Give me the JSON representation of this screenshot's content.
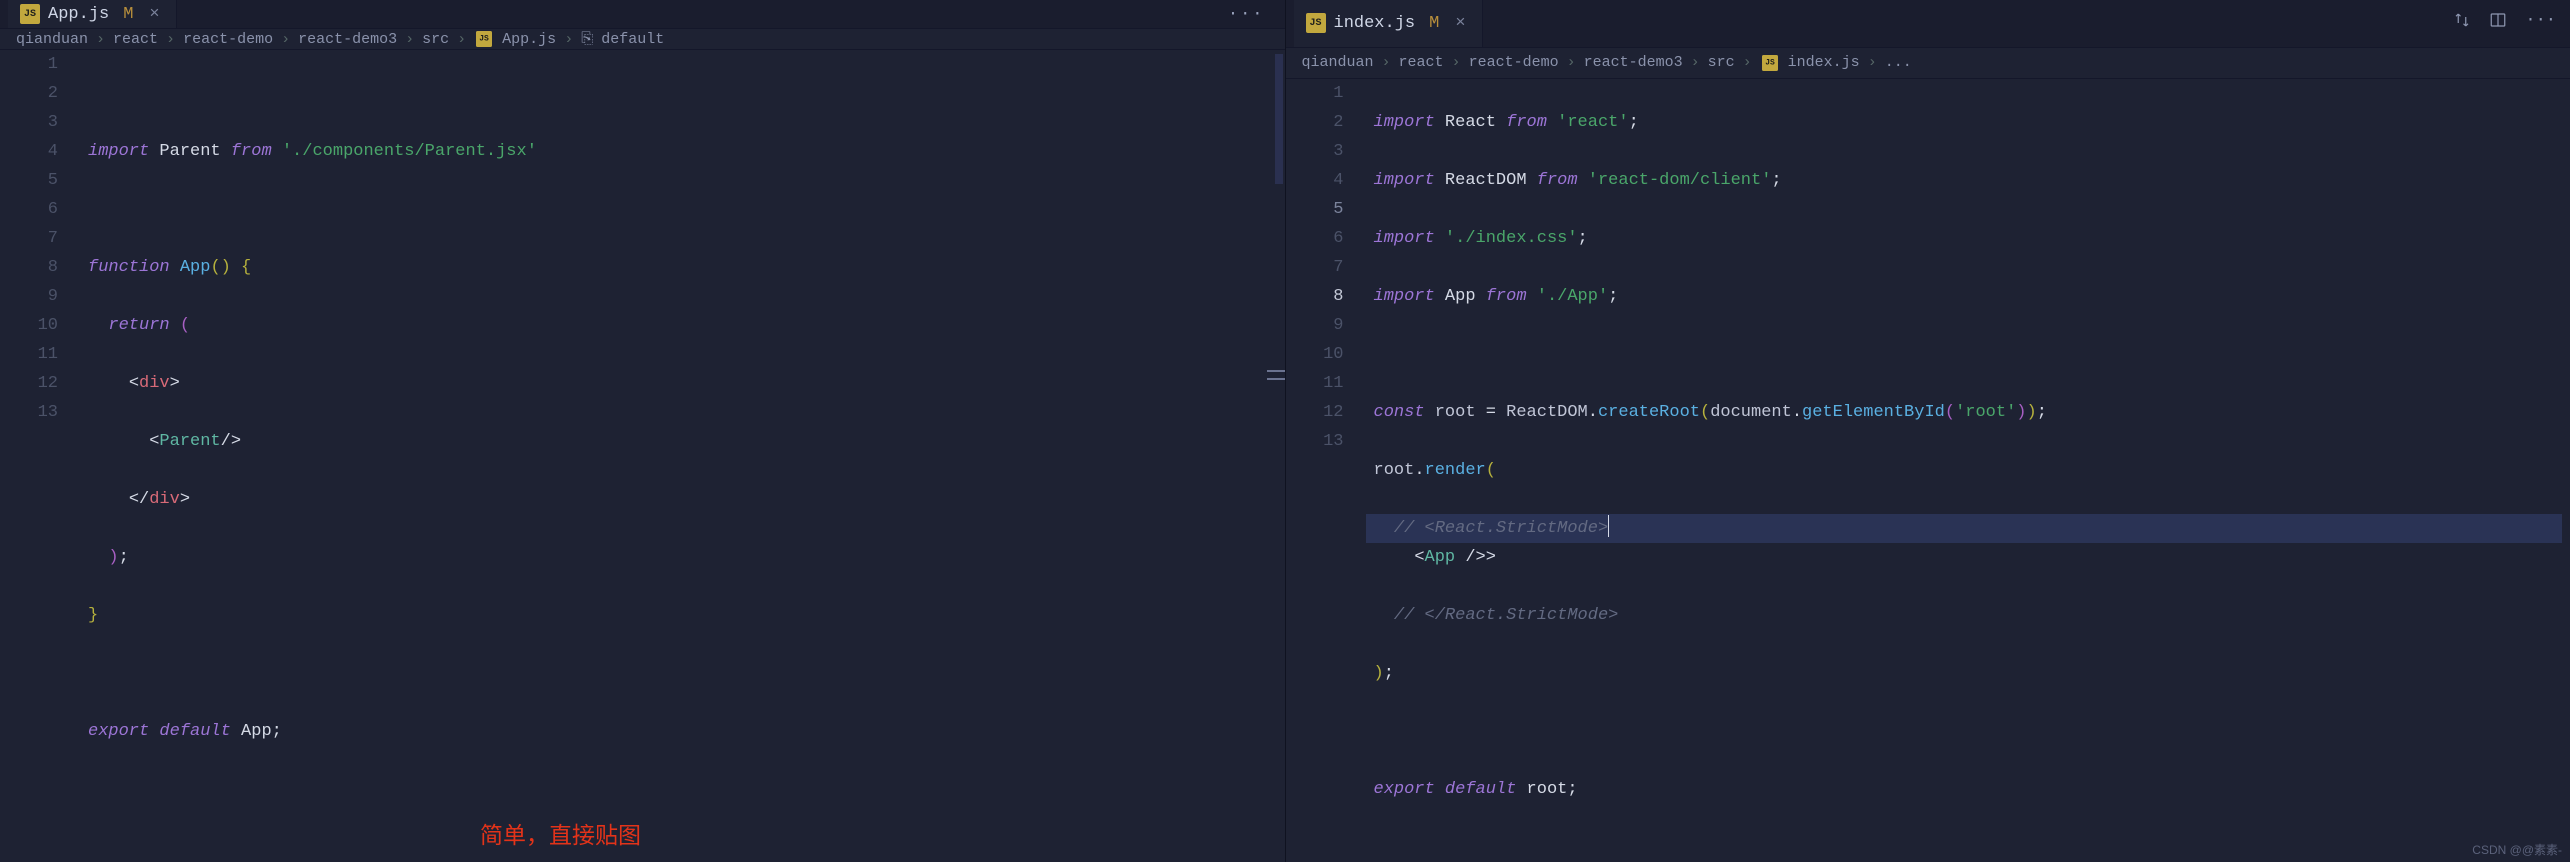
{
  "left": {
    "tab": {
      "icon": "JS",
      "name": "App.js",
      "modified": "M"
    },
    "breadcrumbs": [
      "qianduan",
      "react",
      "react-demo",
      "react-demo3",
      "src",
      "App.js",
      "default"
    ],
    "lines": {
      "1": "",
      "2": {
        "a": "import",
        "b": "Parent",
        "c": "from",
        "d": "'./components/Parent.jsx'"
      },
      "3": "",
      "4": {
        "a": "function",
        "b": "App",
        "c": "()",
        "d": "{"
      },
      "5": {
        "a": "return",
        "b": "("
      },
      "6": {
        "a": "<",
        "b": "div",
        "c": ">"
      },
      "7": {
        "a": "<",
        "b": "Parent",
        "c": "/>"
      },
      "8": {
        "a": "</",
        "b": "div",
        "c": ">"
      },
      "9": {
        "a": ")",
        "b": ";"
      },
      "10": {
        "a": "}"
      },
      "11": "",
      "12": {
        "a": "export",
        "b": "default",
        "c": "App",
        "d": ";"
      },
      "13": ""
    }
  },
  "right": {
    "tab": {
      "icon": "JS",
      "name": "index.js",
      "modified": "M"
    },
    "breadcrumbs": [
      "qianduan",
      "react",
      "react-demo",
      "react-demo3",
      "src",
      "index.js",
      "..."
    ],
    "lines": {
      "1": {
        "a": "import",
        "b": "React",
        "c": "from",
        "d": "'react'",
        "e": ";"
      },
      "2": {
        "a": "import",
        "b": "ReactDOM",
        "c": "from",
        "d": "'react-dom/client'",
        "e": ";"
      },
      "3": {
        "a": "import",
        "b": "'./index.css'",
        "c": ";"
      },
      "4": {
        "a": "import",
        "b": "App",
        "c": "from",
        "d": "'./App'",
        "e": ";"
      },
      "5": "",
      "6": {
        "a": "const",
        "b": "root",
        "c": "=",
        "d": "ReactDOM",
        "e": ".",
        "f": "createRoot",
        "g": "(",
        "h": "document",
        "i": ".",
        "j": "getElementById",
        "k": "(",
        "l": "'root'",
        "m": ")",
        "n": ")",
        "o": ";"
      },
      "7": {
        "a": "root",
        "b": ".",
        "c": "render",
        "d": "("
      },
      "8": {
        "a": "// <React.StrictMode>"
      },
      "9": {
        "a": "<",
        "b": "App",
        "c": " />"
      },
      "10": {
        "a": "// </React.StrictMode>"
      },
      "11": {
        "a": ")",
        "b": ";"
      },
      "12": "",
      "13": {
        "a": "export",
        "b": "default",
        "c": "root",
        "d": ";"
      }
    }
  },
  "annotation": "简单，直接贴图",
  "watermark": "CSDN @@素素-"
}
